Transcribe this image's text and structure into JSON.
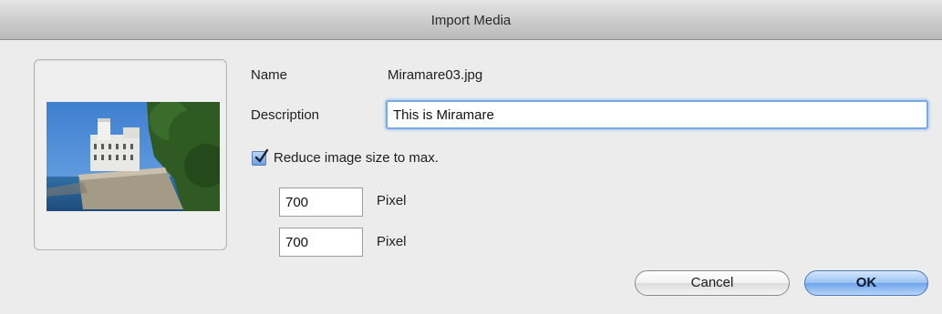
{
  "window": {
    "title": "Import Media"
  },
  "form": {
    "name_label": "Name",
    "name_value": "Miramare03.jpg",
    "description_label": "Description",
    "description_value": "This is Miramare",
    "reduce_checkbox": {
      "label": "Reduce image size to max.",
      "checked": true
    },
    "width": {
      "value": "700",
      "unit": "Pixel"
    },
    "height": {
      "value": "700",
      "unit": "Pixel"
    }
  },
  "buttons": {
    "cancel": "Cancel",
    "ok": "OK"
  },
  "colors": {
    "focus_ring": "#76a9e6",
    "default_button": "#6fa3ea",
    "checkbox": "#6d9fe0"
  },
  "icons": {
    "checkbox_mark": "checkmark-icon"
  }
}
